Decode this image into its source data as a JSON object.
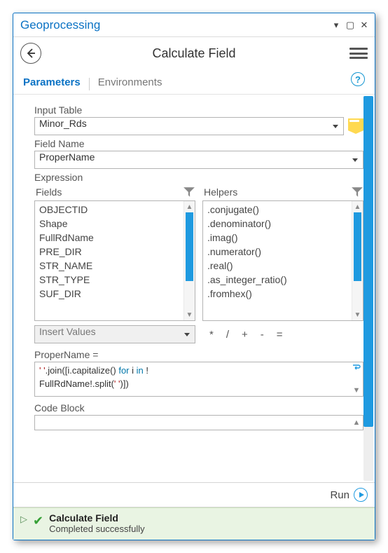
{
  "window": {
    "title": "Geoprocessing"
  },
  "toolbar": {
    "tool_title": "Calculate Field"
  },
  "tabs": {
    "parameters": "Parameters",
    "environments": "Environments"
  },
  "input_table": {
    "label": "Input Table",
    "value": "Minor_Rds"
  },
  "field_name": {
    "label": "Field Name",
    "value": "ProperName"
  },
  "expression": {
    "label": "Expression",
    "fields_label": "Fields",
    "helpers_label": "Helpers",
    "fields": [
      "OBJECTID",
      "Shape",
      "FullRdName",
      "PRE_DIR",
      "STR_NAME",
      "STR_TYPE",
      "SUF_DIR"
    ],
    "helpers": [
      ".conjugate()",
      ".denominator()",
      ".imag()",
      ".numerator()",
      ".real()",
      ".as_integer_ratio()",
      ".fromhex()"
    ],
    "insert_values": "Insert Values",
    "ops": [
      "*",
      "/",
      "+",
      "-",
      "="
    ],
    "target_label": "ProperName =",
    "code_text1_a": "' '",
    "code_text1_b": ".join([i.capitalize() ",
    "code_text1_kw1": "for",
    "code_text1_c": " i ",
    "code_text1_kw2": "in",
    "code_text1_d": " !",
    "code_text2_a": "FullRdName!.split(",
    "code_text2_b": "' '",
    "code_text2_c": ")])",
    "code_block_label": "Code Block"
  },
  "run": {
    "label": "Run"
  },
  "status": {
    "title": "Calculate Field",
    "message": "Completed successfully"
  }
}
